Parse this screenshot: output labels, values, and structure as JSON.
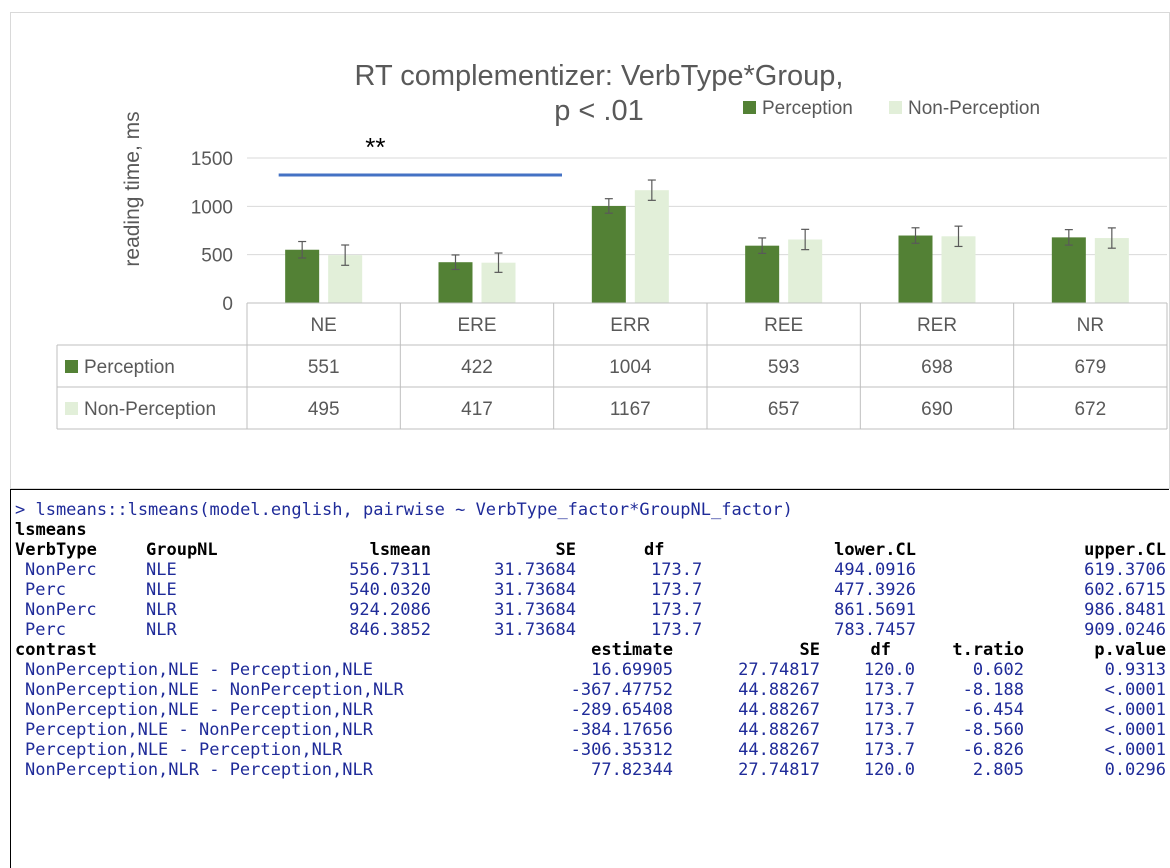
{
  "chart_data": {
    "type": "bar",
    "title": "RT complementizer: VerbType*Group,",
    "subtitle": "p < .01",
    "ylabel": "reading time, ms",
    "xlabel": "",
    "ylim": [
      0,
      1500
    ],
    "yticks": [
      "0",
      "500",
      "1000",
      "1500"
    ],
    "categories": [
      "NE",
      "ERE",
      "ERR",
      "REE",
      "RER",
      "NR"
    ],
    "series": [
      {
        "name": "Perception",
        "color": "#538135",
        "values": [
          551,
          422,
          1004,
          593,
          698,
          679
        ],
        "err": [
          85,
          75,
          75,
          80,
          80,
          80
        ]
      },
      {
        "name": "Non-Perception",
        "color": "#e2efd9",
        "values": [
          495,
          417,
          1167,
          657,
          690,
          672
        ],
        "err": [
          105,
          100,
          105,
          105,
          105,
          105
        ]
      }
    ],
    "legend_position": "top-right",
    "significance": {
      "label": "**",
      "from": "NE",
      "to": "ERE"
    },
    "data_table": true
  },
  "console": {
    "command": "> lsmeans::lsmeans(model.english, pairwise ~ VerbType_factor*GroupNL_factor)",
    "section1": "lsmeans",
    "lsmeans_headers": [
      "VerbType",
      "GroupNL",
      "lsmean",
      "SE",
      "df",
      "lower.CL",
      "upper.CL"
    ],
    "lsmeans_rows": [
      [
        "NonPerc",
        "NLE",
        "556.7311",
        "31.73684",
        "173.7",
        "494.0916",
        "619.3706"
      ],
      [
        "Perc",
        "NLE",
        "540.0320",
        "31.73684",
        "173.7",
        "477.3926",
        "602.6715"
      ],
      [
        "NonPerc",
        "NLR",
        "924.2086",
        "31.73684",
        "173.7",
        "861.5691",
        "986.8481"
      ],
      [
        "Perc",
        "NLR",
        "846.3852",
        "31.73684",
        "173.7",
        "783.7457",
        "909.0246"
      ]
    ],
    "contrast_headers": [
      "contrast",
      "estimate",
      "SE",
      "df",
      "t.ratio",
      "p.value"
    ],
    "contrast_rows": [
      [
        "NonPerception,NLE - Perception,NLE",
        "16.69905",
        "27.74817",
        "120.0",
        "0.602",
        "0.9313"
      ],
      [
        "NonPerception,NLE - NonPerception,NLR",
        "-367.47752",
        "44.88267",
        "173.7",
        "-8.188",
        "<.0001"
      ],
      [
        "NonPerception,NLE - Perception,NLR",
        "-289.65408",
        "44.88267",
        "173.7",
        "-6.454",
        "<.0001"
      ],
      [
        "Perception,NLE - NonPerception,NLR",
        "-384.17656",
        "44.88267",
        "173.7",
        "-8.560",
        "<.0001"
      ],
      [
        "Perception,NLE - Perception,NLR",
        "-306.35312",
        "44.88267",
        "173.7",
        "-6.826",
        "<.0001"
      ],
      [
        "NonPerception,NLR - Perception,NLR",
        "77.82344",
        "27.74817",
        "120.0",
        "2.805",
        "0.0296"
      ]
    ]
  }
}
